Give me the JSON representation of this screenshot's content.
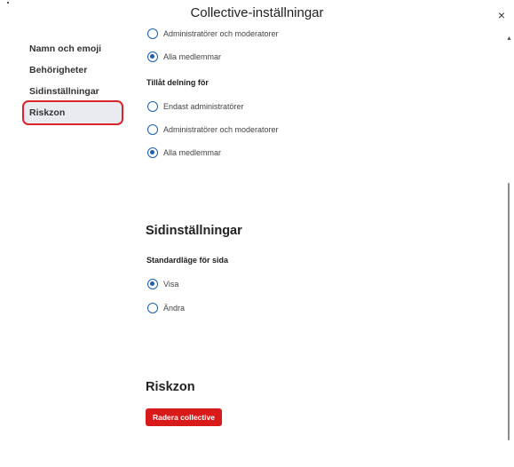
{
  "dialog": {
    "title": "Collective-inställningar",
    "close_symbol": "×"
  },
  "sidebar": {
    "items": [
      {
        "label": "Namn och emoji"
      },
      {
        "label": "Behörigheter"
      },
      {
        "label": "Sidinställningar"
      },
      {
        "label": "Riskzon",
        "active": true
      }
    ]
  },
  "permissions": {
    "top_options": [
      {
        "label": "Administratörer och moderatorer",
        "checked": false
      },
      {
        "label": "Alla medlemmar",
        "checked": true
      }
    ],
    "sharing_label": "Tillåt delning för",
    "sharing_options": [
      {
        "label": "Endast administratörer",
        "checked": false
      },
      {
        "label": "Administratörer och moderatorer",
        "checked": false
      },
      {
        "label": "Alla medlemmar",
        "checked": true
      }
    ]
  },
  "page_settings": {
    "heading": "Sidinställningar",
    "default_mode_label": "Standardläge för sida",
    "options": [
      {
        "label": "Visa",
        "checked": true
      },
      {
        "label": "Ändra",
        "checked": false
      }
    ]
  },
  "danger_zone": {
    "heading": "Riskzon",
    "delete_button": "Radera collective"
  },
  "colors": {
    "accent": "#1a5fb4",
    "danger": "#d91a1a",
    "highlight_outline": "#d8262c"
  }
}
